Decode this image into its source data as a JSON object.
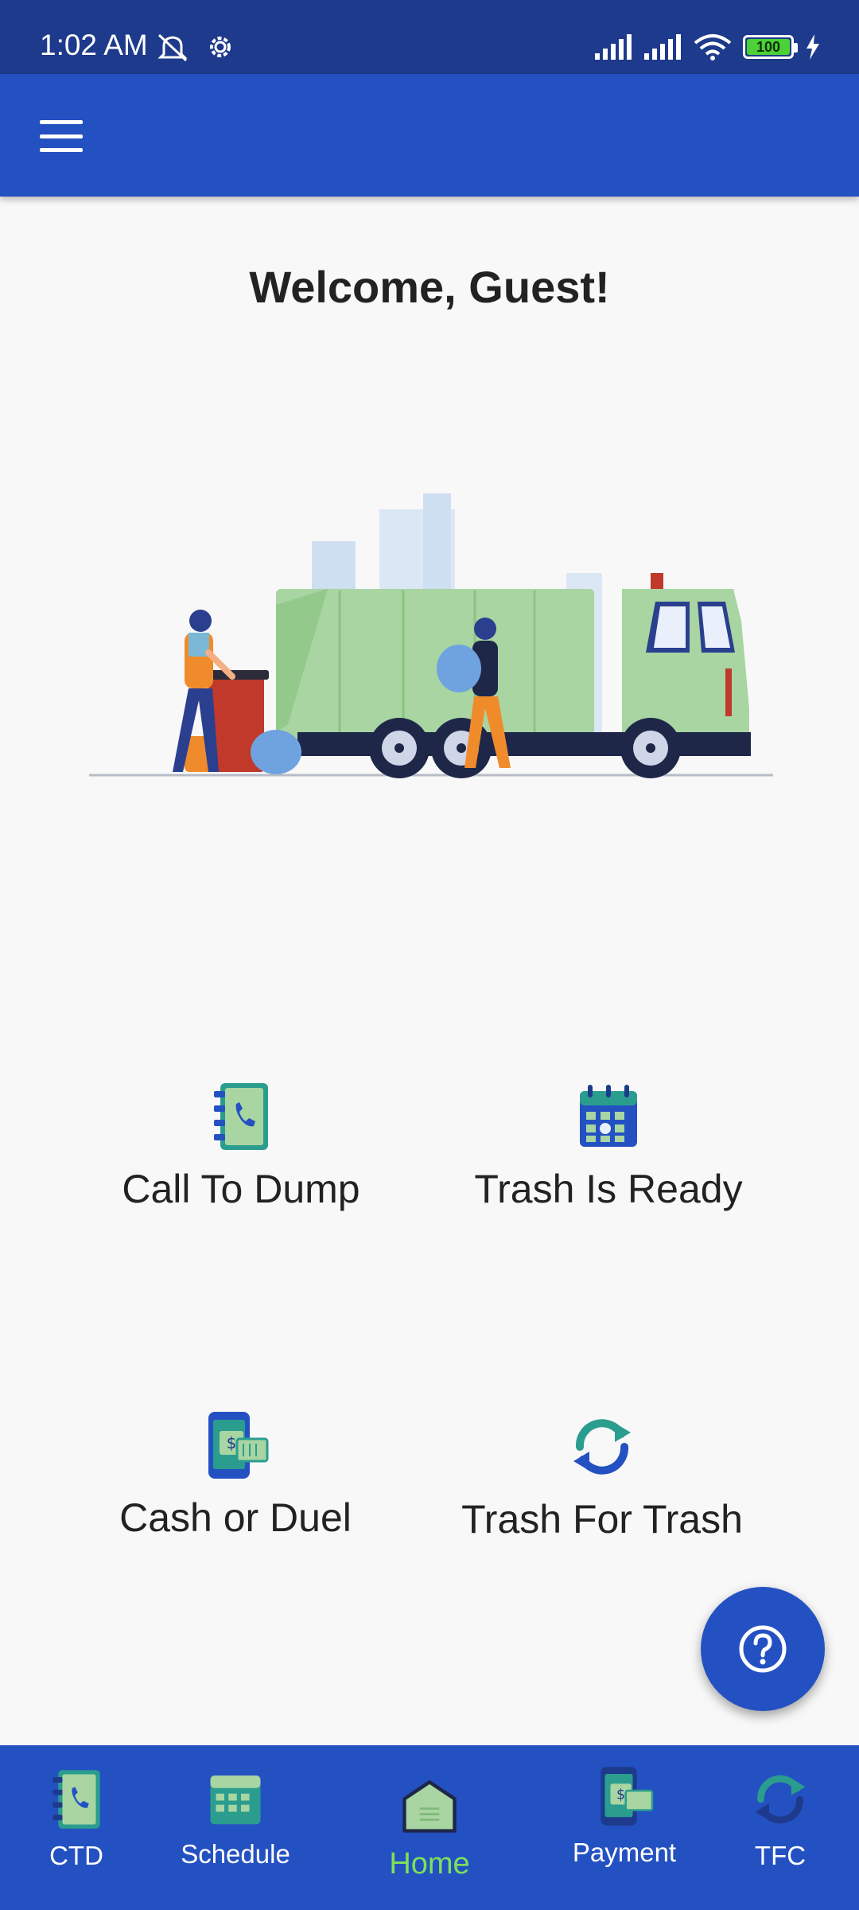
{
  "status_bar": {
    "time": "1:02 AM",
    "battery": "100",
    "icons": [
      "mute-icon",
      "settings-icon",
      "signal-icon",
      "signal-icon",
      "wifi-icon",
      "battery-icon",
      "charging-icon"
    ]
  },
  "app_bar": {
    "menu_icon": "hamburger-menu-icon"
  },
  "welcome": "Welcome, Guest!",
  "tiles": [
    {
      "label": "Call To Dump",
      "icon": "phone-book-icon"
    },
    {
      "label": "Trash Is Ready",
      "icon": "calendar-icon"
    },
    {
      "label": "Cash or Duel",
      "icon": "mobile-payment-icon"
    },
    {
      "label": "Trash For Trash",
      "icon": "recycle-arrows-icon"
    }
  ],
  "fab": {
    "icon": "help-icon"
  },
  "bottom_nav": [
    {
      "label": "CTD",
      "icon": "phone-book-icon"
    },
    {
      "label": "Schedule",
      "icon": "calendar-icon"
    },
    {
      "label": "Home",
      "icon": "home-icon",
      "active": true
    },
    {
      "label": "Payment",
      "icon": "mobile-payment-icon"
    },
    {
      "label": "TFC",
      "icon": "recycle-arrows-icon"
    }
  ],
  "colors": {
    "primary": "#2451c2",
    "status_bar": "#1e3a8c",
    "active_nav": "#7ee05a",
    "truck": "#a8d5a2"
  }
}
